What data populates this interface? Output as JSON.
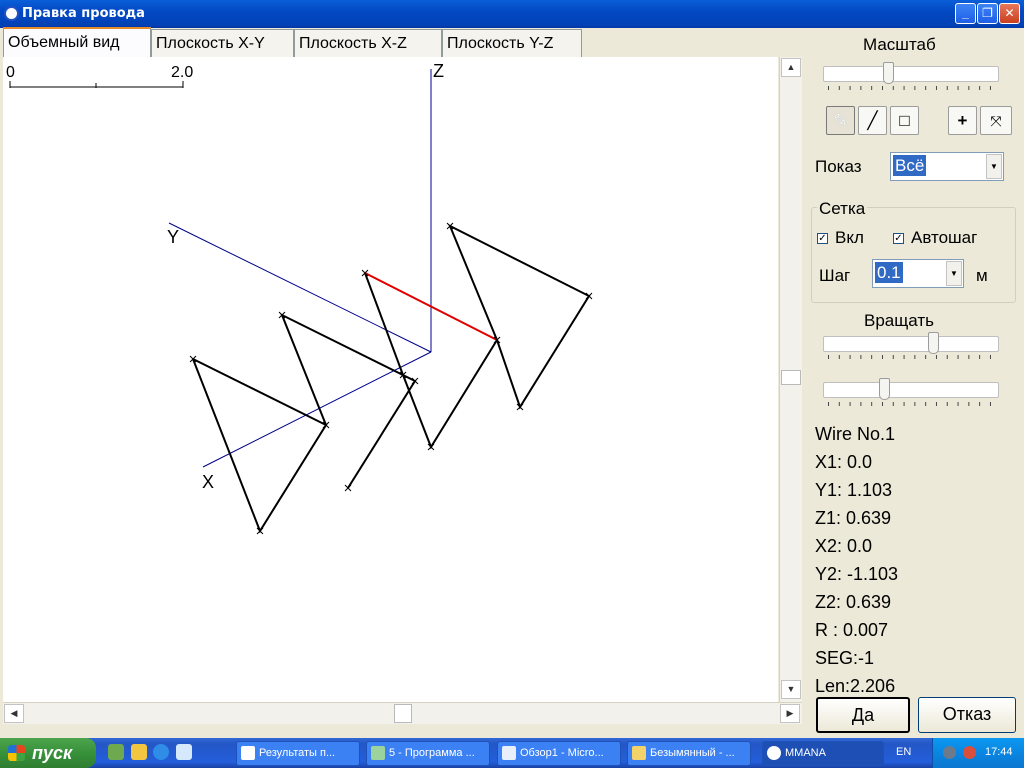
{
  "window": {
    "title": "Правка провода"
  },
  "tabs": [
    {
      "label": "Объемный вид",
      "active": true
    },
    {
      "label": "Плоскость X-Y",
      "active": false
    },
    {
      "label": "Плоскость  X-Z",
      "active": false
    },
    {
      "label": "Плоскость Y-Z",
      "active": false
    }
  ],
  "view": {
    "scale_start": "0",
    "scale_end": "2.0",
    "axis_x": "X",
    "axis_y": "Y",
    "axis_z": "Z",
    "selected_wire_color": "#e00000",
    "axis_color": "#00008b"
  },
  "panel": {
    "scale_label": "Масштаб",
    "show_label": "Показ",
    "show_value": "Всё",
    "grid_group": "Сетка",
    "grid_on_label": "Вкл",
    "grid_on": true,
    "autostep_label": "Автошаг",
    "autostep": true,
    "step_label": "Шаг",
    "step_value": "0.1",
    "step_unit": "м",
    "rotate_label": "Вращать"
  },
  "info": {
    "wire": "Wire No.1",
    "x1": "X1: 0.0",
    "y1": "Y1: 1.103",
    "z1": "Z1: 0.639",
    "x2": "X2: 0.0",
    "y2": "Y2: -1.103",
    "z2": "Z2: 0.639",
    "r": "R : 0.007",
    "seg": "SEG:-1",
    "len": "Len:2.206"
  },
  "buttons": {
    "ok": "Да",
    "cancel": "Отказ"
  },
  "taskbar": {
    "start": "пуск",
    "tasks": [
      "Результаты п...",
      "5 - Программа ...",
      "Обзор1 - Micro...",
      "Безымянный - ...",
      "MMANA"
    ],
    "lang": "EN",
    "clock": "17:44"
  }
}
